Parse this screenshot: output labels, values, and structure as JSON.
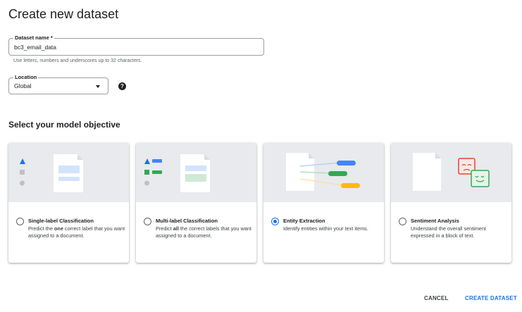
{
  "page": {
    "title": "Create new dataset"
  },
  "dataset_name": {
    "label": "Dataset name *",
    "value": "bc3_email_data",
    "hint": "Use letters, numbers and underscores up to 32 characters."
  },
  "location": {
    "label": "Location",
    "value": "Global",
    "help_icon": "help-icon"
  },
  "objective": {
    "heading": "Select your model objective",
    "options": [
      {
        "title": "Single-label Classification",
        "desc_pre": "Predict the ",
        "desc_bold": "one",
        "desc_post": " correct label that you want assigned to a document.",
        "selected": false
      },
      {
        "title": "Multi-label Classification",
        "desc_pre": "Predict ",
        "desc_bold": "all",
        "desc_post": " the correct labels that you want assigned to a document.",
        "selected": false
      },
      {
        "title": "Entity Extraction",
        "desc_pre": "Identify entities within your text items.",
        "desc_bold": "",
        "desc_post": "",
        "selected": true
      },
      {
        "title": "Sentiment Analysis",
        "desc_pre": "Understand the overall sentiment expressed in a block of text.",
        "desc_bold": "",
        "desc_post": "",
        "selected": false
      }
    ]
  },
  "actions": {
    "cancel": "CANCEL",
    "create": "CREATE DATASET"
  },
  "colors": {
    "accent": "#1a73e8",
    "blue": "#4285f4",
    "green": "#34a853",
    "yellow": "#fbbc04",
    "red": "#ea4335"
  }
}
